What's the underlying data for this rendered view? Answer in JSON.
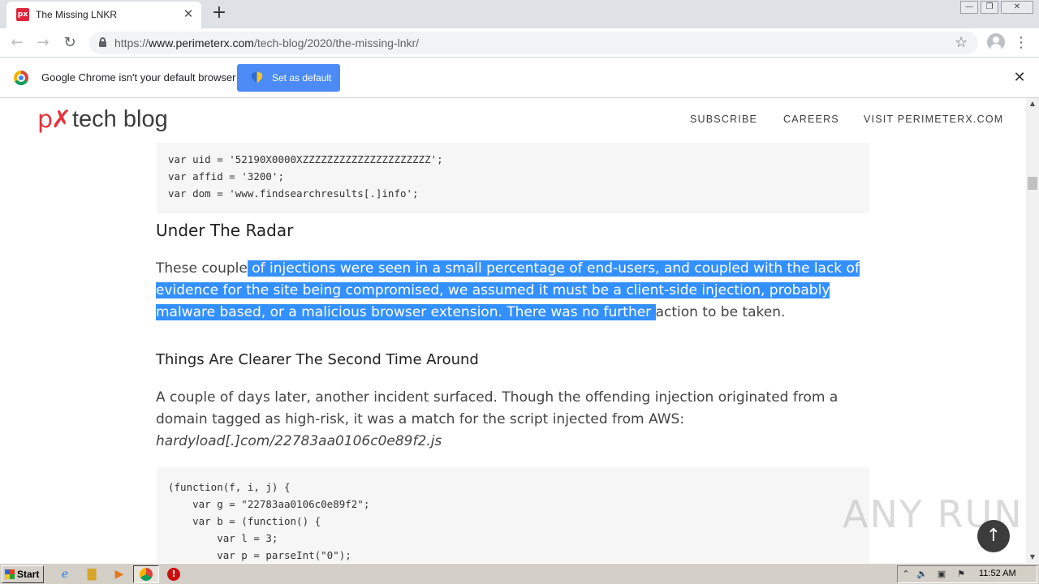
{
  "browser": {
    "tab_title": "The Missing LNKR",
    "tab_favicon_text": "px",
    "url_scheme": "https://",
    "url_host": "www.perimeterx.com",
    "url_path": "/tech-blog/2020/the-missing-lnkr/"
  },
  "infobar": {
    "message": "Google Chrome isn't your default browser",
    "button_label": "Set as default"
  },
  "site": {
    "logo_mark": "p✗",
    "logo_text": "tech blog",
    "nav": [
      "SUBSCRIBE",
      "CAREERS",
      "VISIT PERIMETERX.COM"
    ]
  },
  "article": {
    "code_block_1": [
      "var uid = '52190X0000XZZZZZZZZZZZZZZZZZZZZZ';",
      "var affid = '3200';",
      "var dom = 'www.findsearchresults[.]info';"
    ],
    "heading_1": "Under The Radar",
    "para_1": {
      "line_1_plain": "These couple",
      "line_1_selected": " of injections were seen in a small percentage of end-users, and coupled with the lack of",
      "line_2_selected": "evidence for the site being compromised, we assumed it must be a client-side injection, probably",
      "line_3_selected": "malware based, or a malicious browser extension. There was no further ",
      "line_3_plain": "action to be taken."
    },
    "heading_2": "Things Are Clearer The Second Time Around",
    "para_2": {
      "line_1": "A couple of days later, another incident surfaced. Though the offending injection originated from a",
      "line_2": "domain tagged as high-risk, it was a match for the script injected from AWS:",
      "line_3": "hardyload[.]com/22783aa0106c0e89f2.js"
    },
    "code_block_2": [
      "(function(f, i, j) {",
      "    var g = \"22783aa0106c0e89f2\";",
      "    var b = (function() {",
      "        var l = 3;",
      "        var p = parseInt(\"0\");"
    ]
  },
  "watermark": "ANY RUN",
  "taskbar": {
    "start_label": "Start",
    "clock": "11:52 AM"
  }
}
